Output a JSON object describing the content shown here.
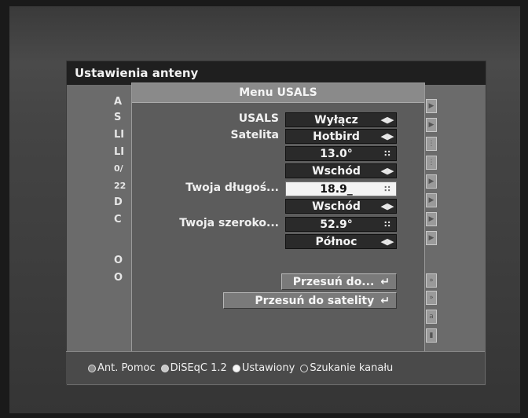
{
  "outer_window": {
    "title": "Ustawienia anteny",
    "partial_labels": [
      "A",
      "S",
      "LI",
      "LI",
      "0/",
      "22",
      "D",
      "C",
      "O",
      "O"
    ]
  },
  "dialog": {
    "title": "Menu USALS",
    "fields": {
      "usals_label": "USALS",
      "usals_value": "Wyłącz",
      "satelita_label": "Satelita",
      "satelita_value": "Hotbird",
      "sat_position_value": "13.0°",
      "sat_direction_value": "Wschód",
      "longitude_label": "Twoja długoś...",
      "longitude_value": "18.9_",
      "longitude_direction_value": "Wschód",
      "latitude_label": "Twoja szeroko...",
      "latitude_value": "52.9°",
      "latitude_direction_value": "Północ"
    },
    "buttons": {
      "move_to": "Przesuń do...",
      "move_to_satellite": "Przesuń do satelity"
    }
  },
  "footer": {
    "items": [
      {
        "label": "Ant. Pomoc",
        "color": "#8a8a8a"
      },
      {
        "label": "DiSEqC 1.2",
        "color": "#c8c8c8"
      },
      {
        "label": "Ustawiony",
        "color": "#f6f6f6"
      },
      {
        "label": "Szukanie kanału",
        "color": "transparent"
      }
    ]
  },
  "icons": {
    "arrows": "left-right-arrows-icon",
    "keypad": "numeric-keypad-icon",
    "enter": "enter-icon"
  }
}
